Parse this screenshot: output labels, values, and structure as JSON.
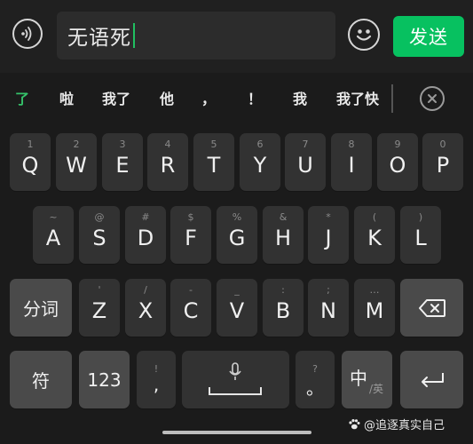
{
  "input": {
    "text": "无语死",
    "send_label": "发送"
  },
  "candidates": [
    "了",
    "啦",
    "我了",
    "他",
    "，",
    "！",
    "我",
    "我了快"
  ],
  "keyboard": {
    "row1": [
      {
        "num": "1",
        "letter": "Q"
      },
      {
        "num": "2",
        "letter": "W"
      },
      {
        "num": "3",
        "letter": "E"
      },
      {
        "num": "4",
        "letter": "R"
      },
      {
        "num": "5",
        "letter": "T"
      },
      {
        "num": "6",
        "letter": "Y"
      },
      {
        "num": "7",
        "letter": "U"
      },
      {
        "num": "8",
        "letter": "I"
      },
      {
        "num": "9",
        "letter": "O"
      },
      {
        "num": "0",
        "letter": "P"
      }
    ],
    "row2": [
      {
        "num": "~",
        "letter": "A"
      },
      {
        "num": "@",
        "letter": "S"
      },
      {
        "num": "#",
        "letter": "D"
      },
      {
        "num": "$",
        "letter": "F"
      },
      {
        "num": "%",
        "letter": "G"
      },
      {
        "num": "&",
        "letter": "H"
      },
      {
        "num": "*",
        "letter": "J"
      },
      {
        "num": "(",
        "letter": "K"
      },
      {
        "num": ")",
        "letter": "L"
      }
    ],
    "row3": [
      {
        "num": "'",
        "letter": "Z"
      },
      {
        "num": "/",
        "letter": "X"
      },
      {
        "num": "-",
        "letter": "C"
      },
      {
        "num": "_",
        "letter": "V"
      },
      {
        "num": ":",
        "letter": "B"
      },
      {
        "num": ";",
        "letter": "N"
      },
      {
        "num": "…",
        "letter": "M"
      }
    ],
    "fenci_label": "分词",
    "symbol_label": "符",
    "num_label": "123",
    "comma_sub": "!",
    "comma_main": ",",
    "period_sub": "?",
    "period_main": "。",
    "lang_main": "中",
    "lang_sub": "/英"
  },
  "watermark": "@追逐真实自己",
  "icons": {
    "voice": "voice-wave-icon",
    "emoji": "smiley-icon",
    "close": "close-circle-icon",
    "backspace": "backspace-icon",
    "microphone": "microphone-icon",
    "enter": "enter-icon"
  },
  "colors": {
    "accent": "#07c160",
    "background": "#1b1b1b",
    "key": "#323232",
    "function_key": "#4a4a4a"
  }
}
